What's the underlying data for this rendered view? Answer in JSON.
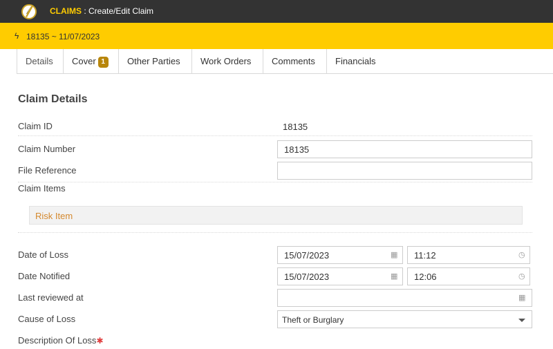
{
  "header": {
    "app_name": "CLAIMS",
    "separator": " : ",
    "page_title": "Create/Edit Claim"
  },
  "context": {
    "icon": "lightning-icon",
    "text": "18135 ~ 11/07/2023"
  },
  "tabs": [
    {
      "label": "Details",
      "active": true
    },
    {
      "label": "Cover",
      "badge": "1"
    },
    {
      "label": "Other Parties"
    },
    {
      "label": "Work Orders"
    },
    {
      "label": "Comments"
    },
    {
      "label": "Financials"
    }
  ],
  "section": {
    "title": "Claim Details"
  },
  "fields": {
    "claim_id": {
      "label": "Claim ID",
      "value": "18135"
    },
    "claim_number": {
      "label": "Claim Number",
      "value": "18135"
    },
    "file_reference": {
      "label": "File Reference",
      "value": ""
    },
    "claim_items": {
      "label": "Claim Items"
    },
    "risk_item": {
      "label": "Risk Item"
    },
    "date_of_loss": {
      "label": "Date of Loss",
      "date": "15/07/2023",
      "time": "11:12"
    },
    "date_notified": {
      "label": "Date Notified",
      "date": "15/07/2023",
      "time": "12:06"
    },
    "last_reviewed": {
      "label": "Last reviewed at",
      "value": ""
    },
    "cause_of_loss": {
      "label": "Cause of Loss",
      "value": "Theft or Burglary"
    },
    "description_of_loss": {
      "label": "Description Of Loss",
      "required_mark": "✱"
    }
  },
  "colors": {
    "topbar": "#333333",
    "accent": "#ffcc00",
    "badge": "#b8860b",
    "link": "#d4892e",
    "required": "#e03c3c"
  }
}
